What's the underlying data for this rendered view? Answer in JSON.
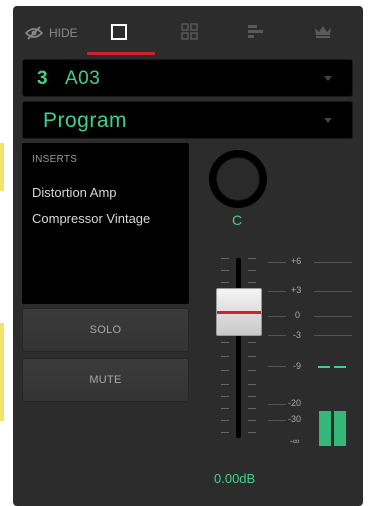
{
  "toolbar": {
    "hide_label": "HIDE",
    "hide_icon": "eye-slash-icon",
    "tabs": [
      {
        "name": "single-channel-icon",
        "active": true
      },
      {
        "name": "grid-icon",
        "active": false
      },
      {
        "name": "bars-icon",
        "active": false
      },
      {
        "name": "crown-icon",
        "active": false
      }
    ]
  },
  "track": {
    "number": "3",
    "name": "A03"
  },
  "program": {
    "name": "Program"
  },
  "inserts": {
    "title": "INSERTS",
    "items": [
      "Distortion Amp",
      "Compressor Vintage"
    ]
  },
  "buttons": {
    "solo": "SOLO",
    "mute": "MUTE"
  },
  "pan": {
    "label": "C"
  },
  "fader": {
    "scale": [
      "+6",
      "+3",
      "0",
      "-3",
      "-9",
      "-20",
      "-30",
      "-∞"
    ],
    "gain": "0.00dB"
  },
  "colors": {
    "accent": "#3fd08e",
    "red": "#d1222b",
    "panel": "#2c2c2c"
  }
}
